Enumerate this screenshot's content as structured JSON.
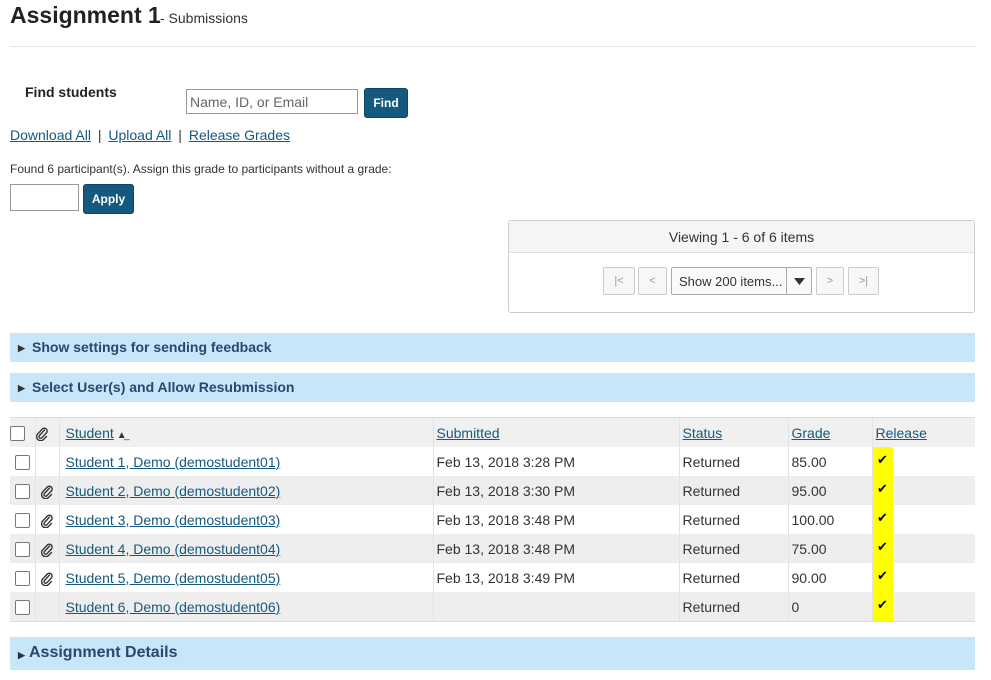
{
  "page": {
    "title": "Assignment 1",
    "subtitle": "- Submissions"
  },
  "find": {
    "label": "Find students",
    "placeholder": "Name, ID, or Email",
    "button": "Find"
  },
  "actions": {
    "download_all": "Download All",
    "separator": "|",
    "upload_all": "Upload All",
    "release_grades": "Release Grades"
  },
  "grade_default": {
    "text": "Found 6 participant(s). Assign this grade to participants without a grade:",
    "value": "",
    "button": "Apply"
  },
  "pager": {
    "viewing": "Viewing 1 - 6 of 6 items",
    "first": "|<",
    "prev": "<",
    "next": ">",
    "last": ">|",
    "page_size": "Show 200 items..."
  },
  "sections": {
    "feedback_settings": "Show settings for sending feedback",
    "resubmission": "Select User(s) and Allow Resubmission",
    "assignment_details": "Assignment Details"
  },
  "table": {
    "headers": {
      "student": "Student",
      "submitted": "Submitted",
      "status": "Status",
      "grade": "Grade",
      "release": "Release"
    },
    "rows": [
      {
        "student": "Student 1, Demo (demostudent01)",
        "submitted": "Feb 13, 2018 3:28 PM",
        "status": "Returned",
        "grade": "85.00",
        "attachment": false,
        "released": true
      },
      {
        "student": "Student 2, Demo (demostudent02)",
        "submitted": "Feb 13, 2018 3:30 PM",
        "status": "Returned",
        "grade": "95.00",
        "attachment": true,
        "released": true
      },
      {
        "student": "Student 3, Demo (demostudent03)",
        "submitted": "Feb 13, 2018 3:48 PM",
        "status": "Returned",
        "grade": "100.00",
        "attachment": true,
        "released": true
      },
      {
        "student": "Student 4, Demo (demostudent04)",
        "submitted": "Feb 13, 2018 3:48 PM",
        "status": "Returned",
        "grade": "75.00",
        "attachment": true,
        "released": true
      },
      {
        "student": "Student 5, Demo (demostudent05)",
        "submitted": "Feb 13, 2018 3:49 PM",
        "status": "Returned",
        "grade": "90.00",
        "attachment": true,
        "released": true
      },
      {
        "student": "Student 6, Demo (demostudent06)",
        "submitted": "",
        "status": "Returned",
        "grade": "0",
        "attachment": false,
        "released": true
      }
    ],
    "release_mark": "✔"
  },
  "colors": {
    "accent": "#15597e",
    "section_bar": "#c8e6fa",
    "release_highlight": "#ffff00"
  },
  "icons": {
    "attachment": "paperclip-icon",
    "sort": "sort-ascending-icon",
    "expand": "caret-right-icon",
    "dropdown": "caret-down-icon"
  }
}
